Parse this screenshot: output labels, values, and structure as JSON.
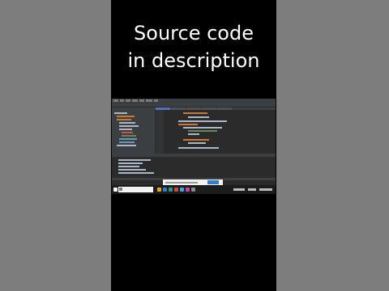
{
  "caption": {
    "line1": "Source code",
    "line2": "in description"
  },
  "colors": {
    "background": "#000000",
    "side_bars": "#7d7d7d",
    "ide_editor": "#2b2b2b",
    "ide_panel": "#3c3f41",
    "taskbar": "#1c1c1c",
    "notification_button": "#2f7dd6"
  },
  "icons": {
    "start": "windows-start-icon",
    "search": "search-icon",
    "file_explorer": "folder-icon",
    "browser": "browser-icon",
    "ide": "ide-icon"
  }
}
